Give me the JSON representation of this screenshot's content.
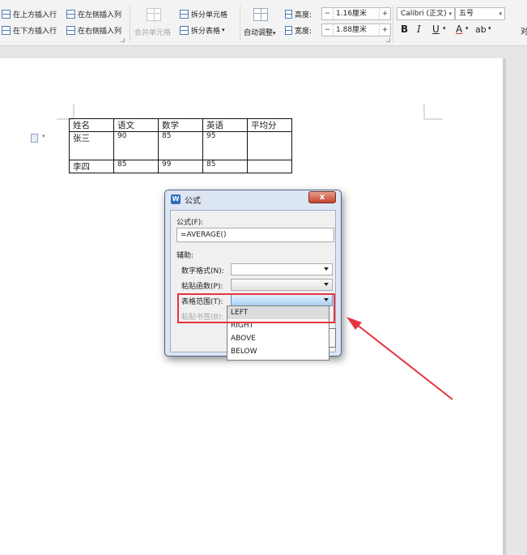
{
  "ribbon": {
    "insert_above": "在上方插入行",
    "insert_below": "在下方插入行",
    "insert_left": "在左侧插入列",
    "insert_right": "在右侧插入列",
    "merge_cells": "合并单元格",
    "split_cells": "拆分单元格",
    "split_table": "拆分表格",
    "auto_fit": "自动调整",
    "height_label": "高度:",
    "height_value": "1.16厘米",
    "width_label": "宽度:",
    "width_value": "1.88厘米",
    "font_name": "Calibri (正文)",
    "font_size": "五号",
    "bold": "B",
    "italic": "I",
    "underline": "U",
    "font_color": "A",
    "highlight": "ab",
    "minus": "−",
    "plus": "+",
    "dropdown_caret": "▾",
    "right_edge": "对"
  },
  "table": {
    "header": [
      "姓名",
      "语文",
      "数学",
      "英语",
      "平均分"
    ],
    "rows": [
      [
        "张三",
        "90",
        "85",
        "95",
        ""
      ],
      [
        "李四",
        "85",
        "99",
        "85",
        ""
      ]
    ]
  },
  "dialog": {
    "title": "公式",
    "close": "x",
    "formula_label": "公式(F):",
    "formula_value": "=AVERAGE()",
    "helper_label": "辅助:",
    "number_format_label": "数字格式(N):",
    "paste_function_label": "粘贴函数(P):",
    "table_range_label": "表格范围(T):",
    "paste_bookmark_label": "粘贴书签(B):"
  },
  "dropdown": {
    "options": [
      "LEFT",
      "RIGHT",
      "ABOVE",
      "BELOW"
    ]
  },
  "colors": {
    "annotation_red": "#e8333f",
    "accent_blue": "#2e6ec4"
  }
}
